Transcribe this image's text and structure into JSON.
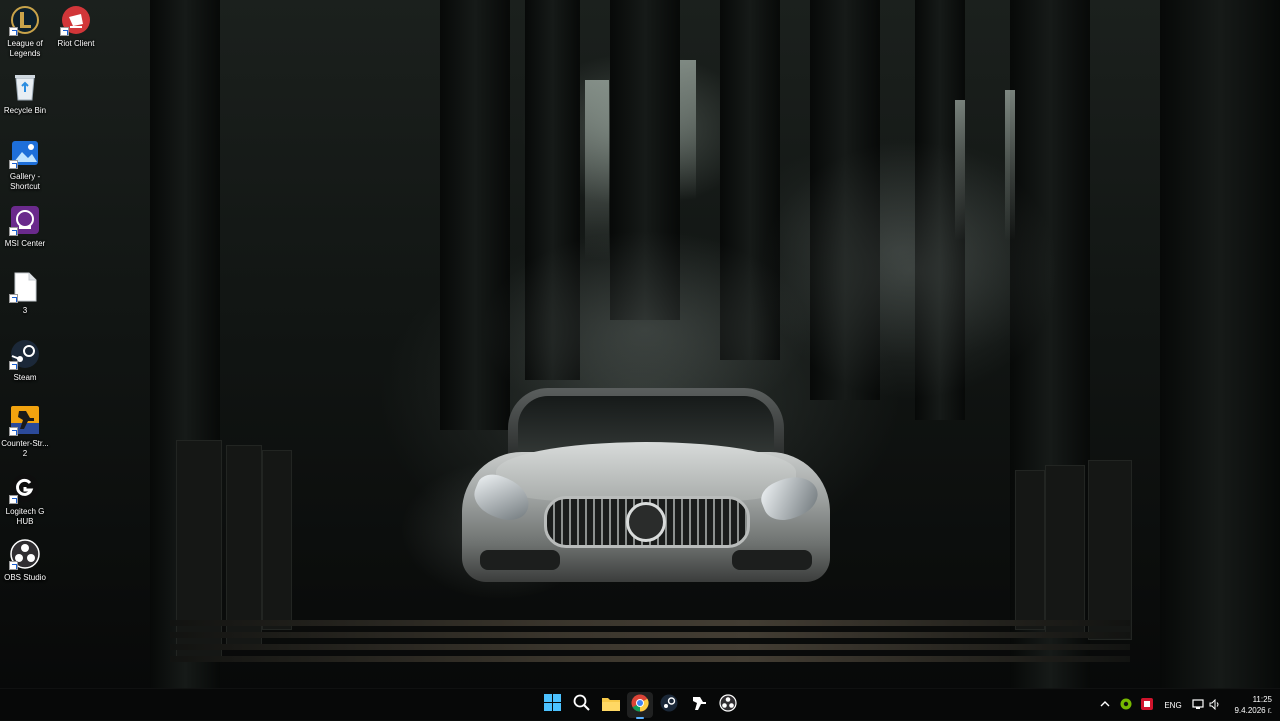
{
  "desktop_icons": [
    {
      "name": "League of Legends",
      "icon": "league-of-legends-icon",
      "shortcut": true
    },
    {
      "name": "Riot Client",
      "icon": "riot-client-icon",
      "shortcut": true
    },
    {
      "name": "Recycle Bin",
      "icon": "recycle-bin-icon",
      "shortcut": false
    },
    {
      "name": "Gallery - Shortcut",
      "icon": "gallery-icon",
      "shortcut": true
    },
    {
      "name": "MSI Center",
      "icon": "msi-center-icon",
      "shortcut": true
    },
    {
      "name": "3",
      "icon": "file-icon",
      "shortcut": true
    },
    {
      "name": "Steam",
      "icon": "steam-icon",
      "shortcut": true
    },
    {
      "name": "Counter-Str... 2",
      "icon": "counter-strike-icon",
      "shortcut": true
    },
    {
      "name": "Logitech G HUB",
      "icon": "logitech-g-hub-icon",
      "shortcut": true
    },
    {
      "name": "OBS Studio",
      "icon": "obs-studio-icon",
      "shortcut": true
    }
  ],
  "taskbar": {
    "pinned": [
      {
        "icon": "windows-start-icon",
        "active": false
      },
      {
        "icon": "search-icon",
        "active": false
      },
      {
        "icon": "file-explorer-icon",
        "active": false
      },
      {
        "icon": "chrome-icon",
        "active": true
      },
      {
        "icon": "steam-icon",
        "active": false
      },
      {
        "icon": "counter-strike-icon",
        "active": false
      },
      {
        "icon": "obs-studio-icon",
        "active": false
      }
    ],
    "tray": {
      "language": "ENG",
      "icons": [
        "chevron-up-icon",
        "nvidia-icon",
        "msi-icon",
        "network-icon",
        "volume-icon"
      ]
    },
    "clock": {
      "time": "11:25",
      "date": "9.4.2026 г."
    }
  },
  "colors": {
    "taskbar": "#080909",
    "accent": "#5ab0ff",
    "label_text": "#ffffff"
  }
}
